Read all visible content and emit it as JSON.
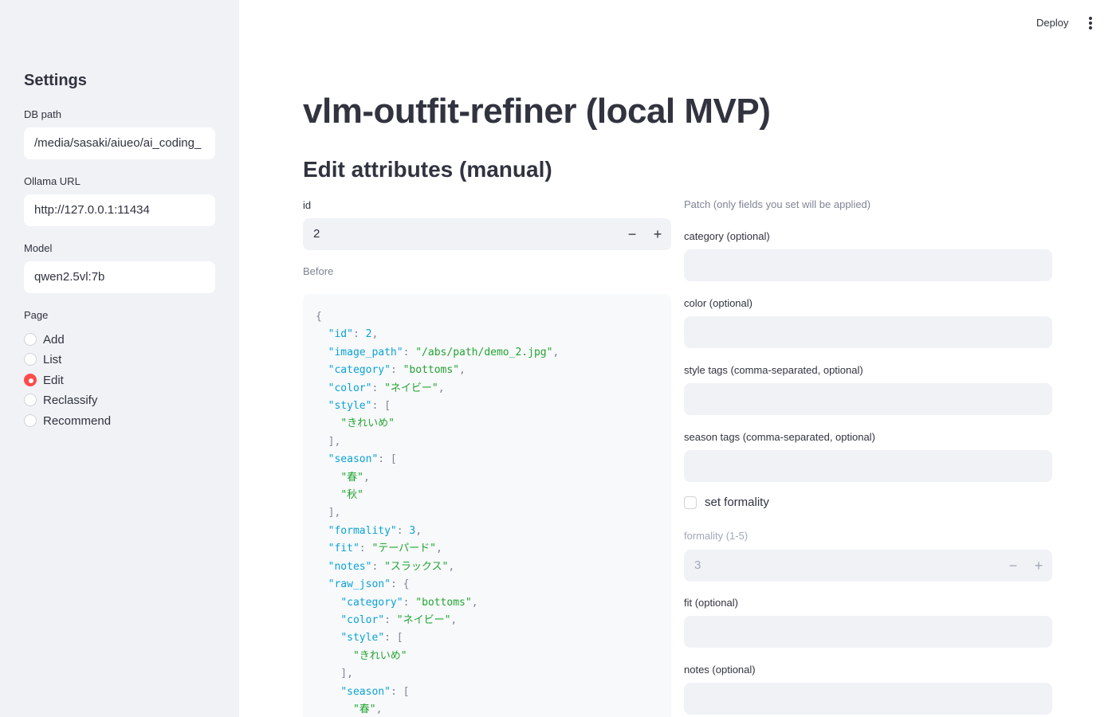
{
  "header": {
    "deploy_label": "Deploy",
    "menu_icon": "vertical-dots-icon"
  },
  "sidebar": {
    "title": "Settings",
    "db_path": {
      "label": "DB path",
      "value": "/media/sasaki/aiueo/ai_coding_"
    },
    "ollama_url": {
      "label": "Ollama URL",
      "value": "http://127.0.0.1:11434"
    },
    "model": {
      "label": "Model",
      "value": "qwen2.5vl:7b"
    },
    "page": {
      "label": "Page",
      "options": [
        "Add",
        "List",
        "Edit",
        "Reclassify",
        "Recommend"
      ],
      "selected": "Edit"
    }
  },
  "main": {
    "title": "vlm-outfit-refiner (local MVP)",
    "subtitle": "Edit attributes (manual)",
    "id_field": {
      "label": "id",
      "value": "2",
      "minus": "−",
      "plus": "+"
    },
    "before_label": "Before",
    "before_json": [
      [
        [
          "p",
          "{"
        ]
      ],
      [
        [
          "p",
          "  "
        ],
        [
          "k",
          "\"id\""
        ],
        [
          "p",
          ": "
        ],
        [
          "n",
          "2"
        ],
        [
          "p",
          ","
        ]
      ],
      [
        [
          "p",
          "  "
        ],
        [
          "k",
          "\"image_path\""
        ],
        [
          "p",
          ": "
        ],
        [
          "s",
          "\"/abs/path/demo_2.jpg\""
        ],
        [
          "p",
          ","
        ]
      ],
      [
        [
          "p",
          "  "
        ],
        [
          "k",
          "\"category\""
        ],
        [
          "p",
          ": "
        ],
        [
          "s",
          "\"bottoms\""
        ],
        [
          "p",
          ","
        ]
      ],
      [
        [
          "p",
          "  "
        ],
        [
          "k",
          "\"color\""
        ],
        [
          "p",
          ": "
        ],
        [
          "s",
          "\"ネイビー\""
        ],
        [
          "p",
          ","
        ]
      ],
      [
        [
          "p",
          "  "
        ],
        [
          "k",
          "\"style\""
        ],
        [
          "p",
          ": ["
        ]
      ],
      [
        [
          "p",
          "    "
        ],
        [
          "s",
          "\"きれいめ\""
        ]
      ],
      [
        [
          "p",
          "  ],"
        ]
      ],
      [
        [
          "p",
          "  "
        ],
        [
          "k",
          "\"season\""
        ],
        [
          "p",
          ": ["
        ]
      ],
      [
        [
          "p",
          "    "
        ],
        [
          "s",
          "\"春\""
        ],
        [
          "p",
          ","
        ]
      ],
      [
        [
          "p",
          "    "
        ],
        [
          "s",
          "\"秋\""
        ]
      ],
      [
        [
          "p",
          "  ],"
        ]
      ],
      [
        [
          "p",
          "  "
        ],
        [
          "k",
          "\"formality\""
        ],
        [
          "p",
          ": "
        ],
        [
          "n",
          "3"
        ],
        [
          "p",
          ","
        ]
      ],
      [
        [
          "p",
          "  "
        ],
        [
          "k",
          "\"fit\""
        ],
        [
          "p",
          ": "
        ],
        [
          "s",
          "\"テーパード\""
        ],
        [
          "p",
          ","
        ]
      ],
      [
        [
          "p",
          "  "
        ],
        [
          "k",
          "\"notes\""
        ],
        [
          "p",
          ": "
        ],
        [
          "s",
          "\"スラックス\""
        ],
        [
          "p",
          ","
        ]
      ],
      [
        [
          "p",
          "  "
        ],
        [
          "k",
          "\"raw_json\""
        ],
        [
          "p",
          ": {"
        ]
      ],
      [
        [
          "p",
          "    "
        ],
        [
          "k",
          "\"category\""
        ],
        [
          "p",
          ": "
        ],
        [
          "s",
          "\"bottoms\""
        ],
        [
          "p",
          ","
        ]
      ],
      [
        [
          "p",
          "    "
        ],
        [
          "k",
          "\"color\""
        ],
        [
          "p",
          ": "
        ],
        [
          "s",
          "\"ネイビー\""
        ],
        [
          "p",
          ","
        ]
      ],
      [
        [
          "p",
          "    "
        ],
        [
          "k",
          "\"style\""
        ],
        [
          "p",
          ": ["
        ]
      ],
      [
        [
          "p",
          "      "
        ],
        [
          "s",
          "\"きれいめ\""
        ]
      ],
      [
        [
          "p",
          "    ],"
        ]
      ],
      [
        [
          "p",
          "    "
        ],
        [
          "k",
          "\"season\""
        ],
        [
          "p",
          ": ["
        ]
      ],
      [
        [
          "p",
          "      "
        ],
        [
          "s",
          "\"春\""
        ],
        [
          "p",
          ","
        ]
      ]
    ],
    "patch": {
      "caption": "Patch (only fields you set will be applied)",
      "category_label": "category (optional)",
      "color_label": "color (optional)",
      "style_label": "style tags (comma-separated, optional)",
      "season_label": "season tags (comma-separated, optional)",
      "set_formality_label": "set formality",
      "formality_label": "formality (1-5)",
      "formality_value": "3",
      "fit_label": "fit (optional)",
      "notes_label": "notes (optional)"
    }
  }
}
